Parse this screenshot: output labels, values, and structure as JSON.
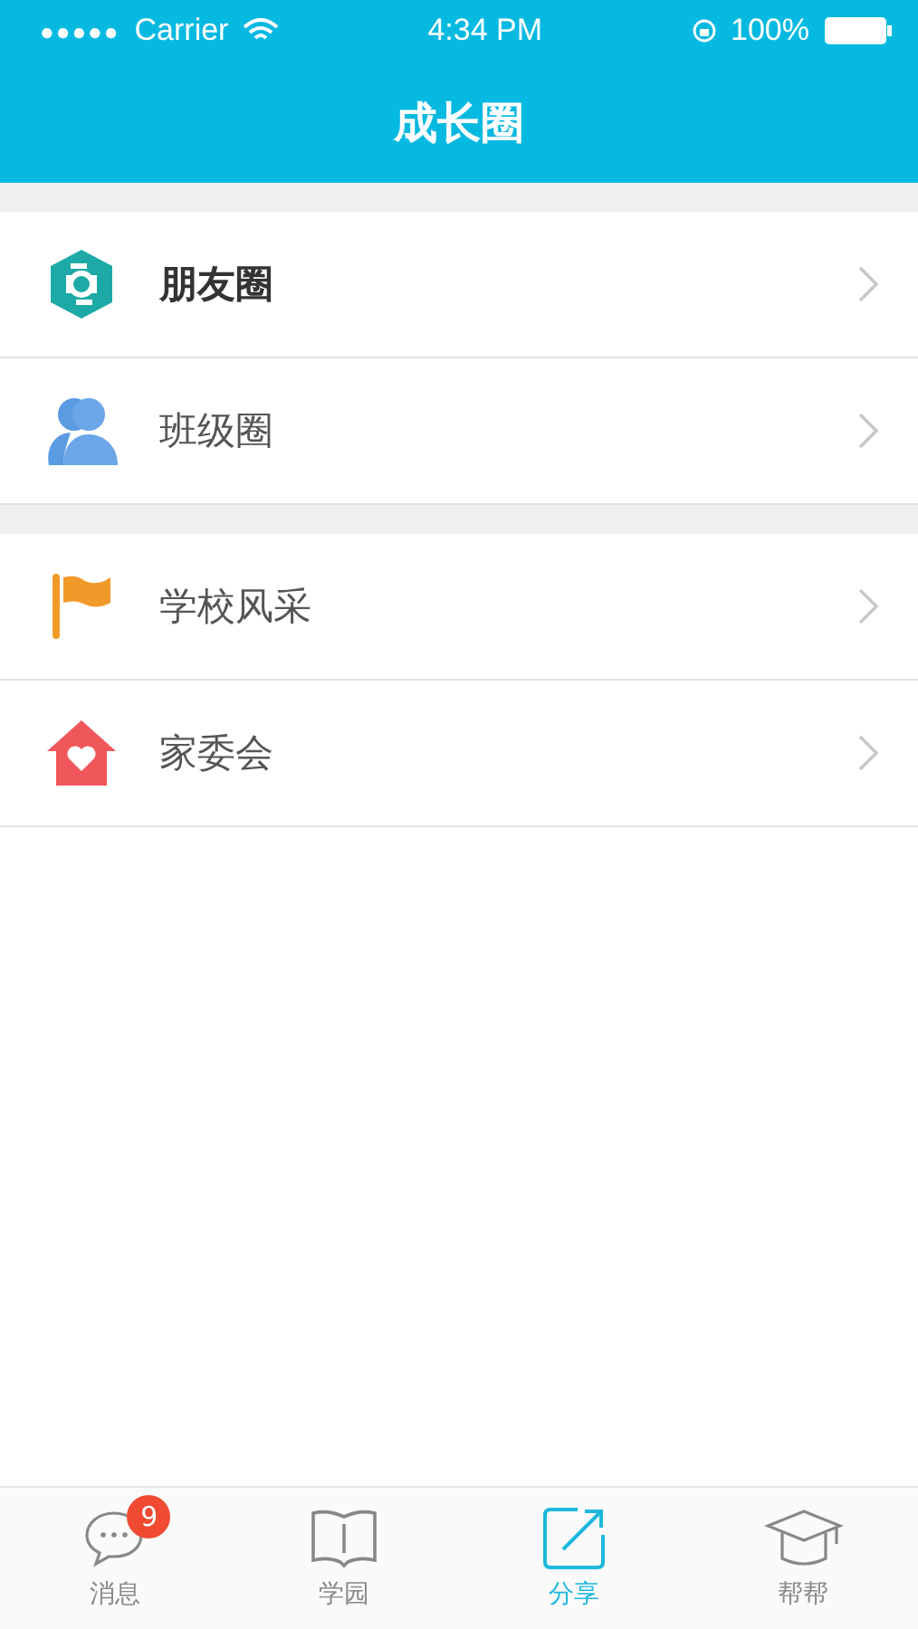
{
  "status_bar": {
    "signal": "●●●●●",
    "carrier": "Carrier",
    "time": "4:34 PM",
    "battery": "100%"
  },
  "nav_bar": {
    "title": "成长圈"
  },
  "sections": [
    {
      "items": [
        {
          "label": "朋友圈",
          "bold": true
        },
        {
          "label": "班级圈",
          "bold": false
        }
      ]
    },
    {
      "items": [
        {
          "label": "学校风采",
          "bold": false
        },
        {
          "label": "家委会",
          "bold": false
        }
      ]
    }
  ],
  "tab_bar": [
    {
      "label": "消息",
      "selected": false,
      "badge": "9"
    },
    {
      "label": "学园",
      "selected": false
    },
    {
      "label": "分享",
      "selected": true
    },
    {
      "label": "帮帮",
      "selected": false
    }
  ]
}
